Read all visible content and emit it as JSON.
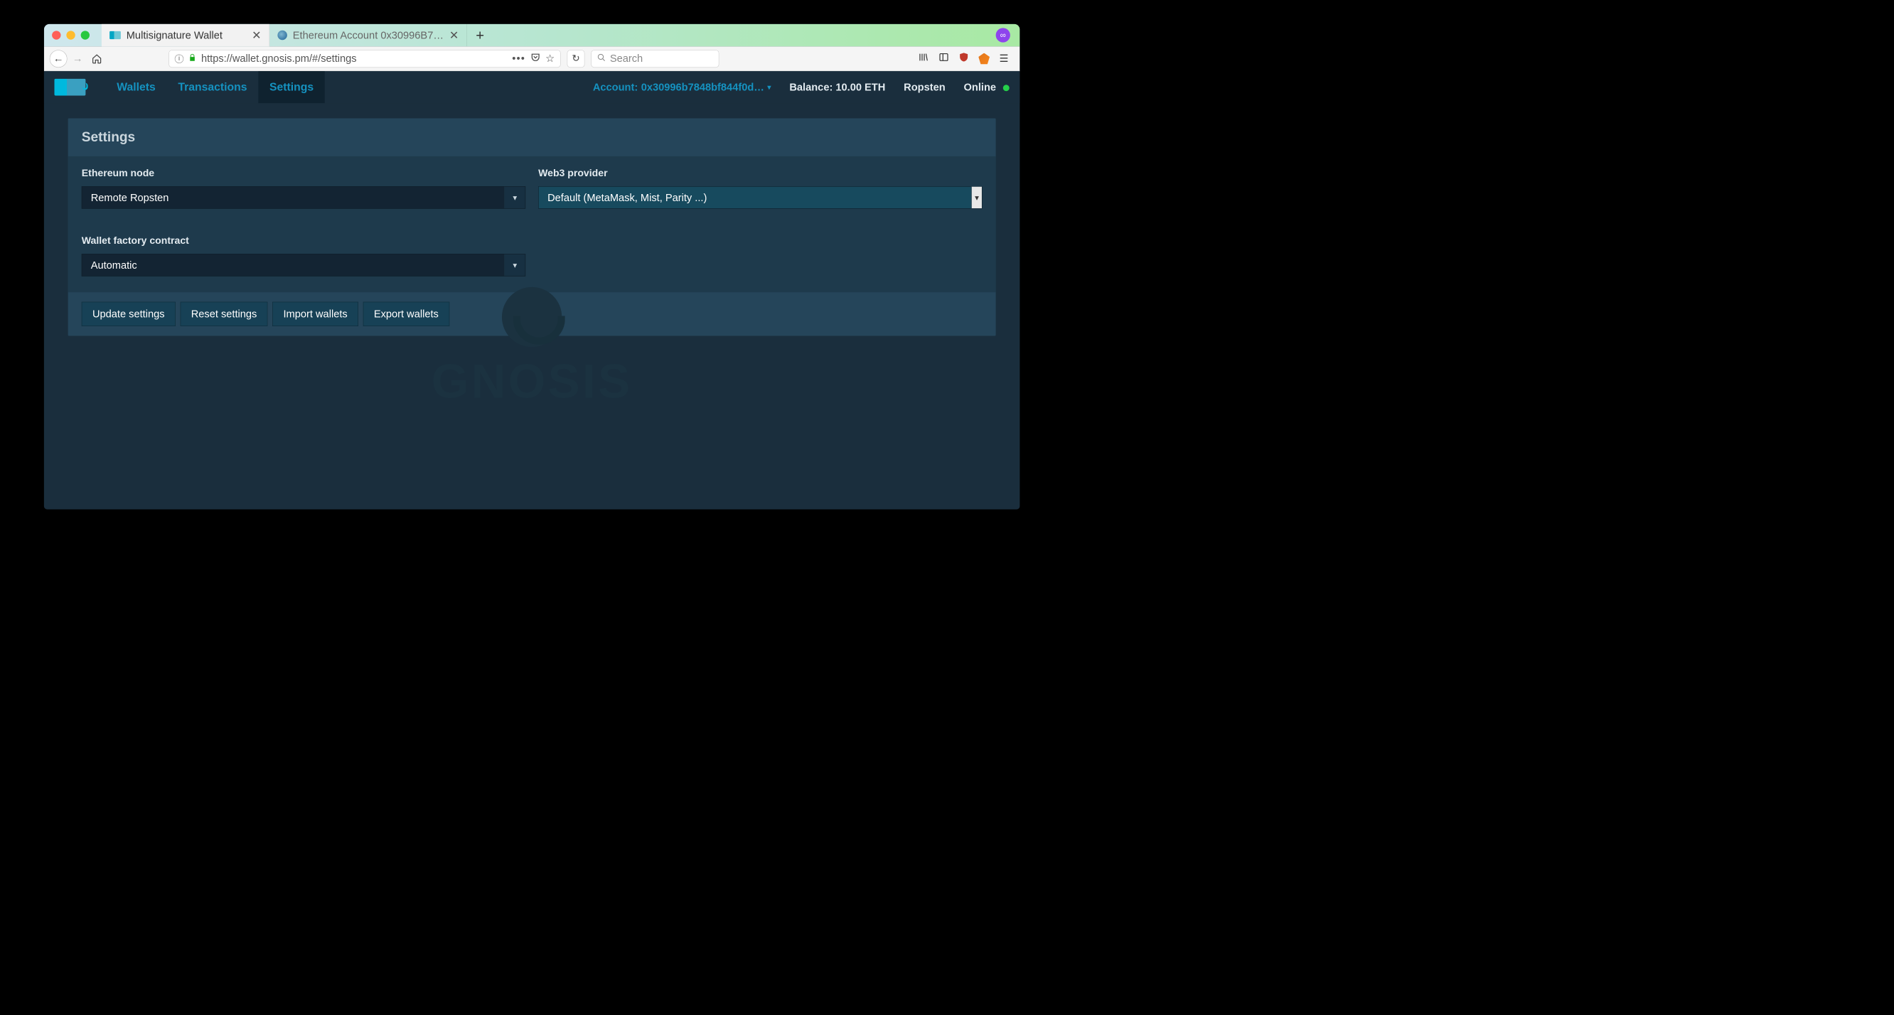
{
  "browser": {
    "tabs": [
      {
        "title": "Multisignature Wallet",
        "active": true
      },
      {
        "title": "Ethereum Account 0x30996B7…",
        "active": false
      }
    ],
    "url": "https://wallet.gnosis.pm/#/settings",
    "search_placeholder": "Search"
  },
  "nav": {
    "links": {
      "wallets": "Wallets",
      "transactions": "Transactions",
      "settings": "Settings"
    },
    "account_prefix": "Account: ",
    "account_hash": "0x30996b7848bf844f0d…",
    "balance": "Balance: 10.00 ETH",
    "network": "Ropsten",
    "status": "Online"
  },
  "page": {
    "title": "Settings",
    "ethereum_node_label": "Ethereum node",
    "ethereum_node_value": "Remote Ropsten",
    "web3_label": "Web3 provider",
    "web3_value": "Default (MetaMask, Mist, Parity ...)",
    "factory_label": "Wallet factory contract",
    "factory_value": "Automatic",
    "buttons": {
      "update": "Update settings",
      "reset": "Reset settings",
      "import": "Import wallets",
      "export": "Export wallets"
    }
  },
  "watermark": "GNOSIS"
}
